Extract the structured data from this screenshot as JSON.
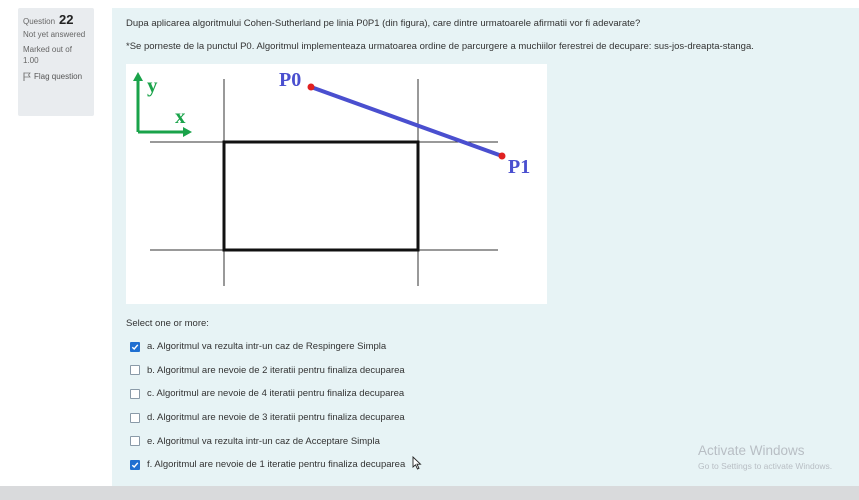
{
  "info": {
    "question_label": "Question",
    "question_number": "22",
    "state": "Not yet answered",
    "marked_out_of_label": "Marked out of",
    "marked_out_of_value": "1.00",
    "flag_label": "Flag question"
  },
  "question": {
    "text": "Dupa aplicarea algoritmului Cohen-Sutherland pe linia P0P1 (din figura), care dintre urmatoarele afirmatii vor fi adevarate?",
    "note": "*Se porneste de la punctul P0. Algoritmul implementeaza urmatoarea ordine de parcurgere a muchiilor ferestrei de decupare: sus-jos-dreapta-stanga."
  },
  "figure": {
    "y_label": "y",
    "x_label": "x",
    "p0_label": "P0",
    "p1_label": "P1",
    "line_color": "#4a4fcf",
    "point_color": "#e02020",
    "axis_color": "#1aa34a"
  },
  "select_prompt": "Select one or more:",
  "answers": [
    {
      "label": "a. Algoritmul va rezulta intr-un caz de Respingere Simpla",
      "checked": true
    },
    {
      "label": "b. Algoritmul are nevoie de 2 iteratii pentru finaliza decuparea",
      "checked": false
    },
    {
      "label": "c. Algoritmul are nevoie de 4 iteratii pentru finaliza decuparea",
      "checked": false
    },
    {
      "label": "d. Algoritmul are nevoie de 3 iteratii pentru finaliza decuparea",
      "checked": false
    },
    {
      "label": "e. Algoritmul va rezulta intr-un caz de Acceptare Simpla",
      "checked": false
    },
    {
      "label": "f. Algoritmul are nevoie de 1 iteratie pentru finaliza decuparea",
      "checked": true
    }
  ],
  "watermark": {
    "title": "Activate Windows",
    "subtitle": "Go to Settings to activate Windows."
  },
  "colors": {
    "panel_bg": "#e7f3f5",
    "info_bg": "#e9ecef",
    "checkbox_checked": "#1f6fd1"
  }
}
